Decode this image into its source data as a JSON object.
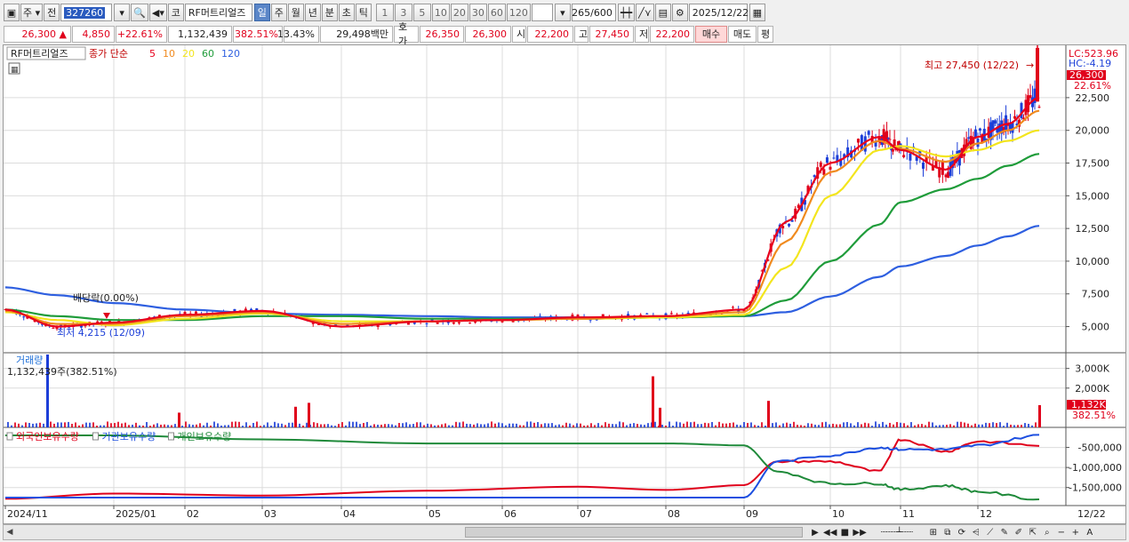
{
  "toolbar": {
    "market_label": "주",
    "prev_label": "전",
    "code_value": "327260",
    "name_label": "코",
    "stock_name": "RF머트리얼즈",
    "period_buttons": [
      "일",
      "주",
      "월",
      "년",
      "분",
      "초",
      "틱"
    ],
    "selected_period": "일",
    "interval_buttons": [
      "1",
      "3",
      "5",
      "10",
      "20",
      "30",
      "60",
      "120"
    ],
    "count_value": "265",
    "count_total": "/600",
    "date_value": "2025/12/22"
  },
  "price_bar": {
    "price": "26,300",
    "change_arrow": "▲",
    "change": "4,850",
    "change_pct": "+22.61%",
    "volume": "1,132,439",
    "volume_ratio": "382.51%",
    "turnover": "13.43%",
    "amount": "29,498백만",
    "quote_label": "호가",
    "quote_ask": "26,350",
    "quote_bid": "26,300",
    "open_label": "시",
    "open": "22,200",
    "high_label": "고",
    "high": "27,450",
    "low_label": "저",
    "low": "22,200",
    "buy_label": "매수",
    "sell_label": "매도",
    "eval_label": "평"
  },
  "chart": {
    "legend_name": "RF머트리얼즈",
    "legend_series": "종가 단순",
    "ma_periods": [
      "5",
      "10",
      "20",
      "60",
      "120"
    ],
    "ma_colors": [
      "#e8001c",
      "#f08a1e",
      "#f3e51d",
      "#1f9c3a",
      "#2e5fe0"
    ],
    "lc_label": "LC:523.96",
    "hc_label": "HC:-4.19",
    "price_tag": "26,300",
    "pct_tag": "22.61%",
    "high_annotation": "최고 27,450 (12/22)",
    "low_annotation": "최저 4,215 (12/09)",
    "dividend_label": "배당락(0.00%)",
    "volume_title": "거래량",
    "volume_value": "1,132,439주(382.51%)",
    "volume_tag": "1,132K",
    "volume_pct_tag": "382.51%",
    "holdings_legend": [
      "외국인보유수량",
      "기관보유수량",
      "개인보유수량"
    ],
    "holdings_colors": [
      "#e0001b",
      "#1d4fe0",
      "#1f8a3a"
    ],
    "last_date_label": "12/22"
  },
  "chart_data": [
    {
      "type": "line",
      "title": "",
      "x_tick_labels": [
        "2024/11",
        "2025/01",
        "02",
        "03",
        "04",
        "05",
        "06",
        "07",
        "08",
        "09",
        "10",
        "11",
        "12"
      ],
      "y_ticks": [
        5000,
        7500,
        10000,
        12500,
        15000,
        17500,
        20000,
        22500
      ],
      "y_tick_labels": [
        "5,000",
        "7,500",
        "10,000",
        "12,500",
        "15,000",
        "17,500",
        "20,000",
        "22,500"
      ],
      "ylim": [
        3000,
        26500
      ],
      "x": [
        "2024/11",
        "2024/12",
        "2025/01",
        "02",
        "03",
        "04",
        "05",
        "06",
        "07",
        "08",
        "09-early",
        "09-late",
        "10-early",
        "10-late",
        "11-early",
        "11-late",
        "12-early",
        "12-mid",
        "12/22"
      ],
      "series": [
        {
          "name": "5",
          "values": [
            6300,
            5000,
            5300,
            5900,
            6200,
            5000,
            5400,
            5500,
            5700,
            5800,
            6300,
            13000,
            17500,
            19500,
            18500,
            17000,
            19500,
            20500,
            22500
          ]
        },
        {
          "name": "10",
          "values": [
            6200,
            5200,
            5200,
            5800,
            6100,
            5200,
            5400,
            5500,
            5600,
            5800,
            6100,
            11500,
            16800,
            19200,
            18600,
            17600,
            19000,
            20000,
            21500
          ]
        },
        {
          "name": "20",
          "values": [
            6100,
            5500,
            5100,
            5600,
            6000,
            5400,
            5400,
            5500,
            5600,
            5700,
            5900,
            9500,
            15000,
            18500,
            18800,
            18000,
            18500,
            19200,
            20000
          ]
        },
        {
          "name": "60",
          "values": [
            6300,
            5800,
            5500,
            5500,
            5800,
            5800,
            5600,
            5600,
            5600,
            5700,
            5800,
            7000,
            10000,
            12800,
            14500,
            15500,
            16300,
            17300,
            18200
          ]
        },
        {
          "name": "120",
          "values": [
            8000,
            7400,
            6800,
            6300,
            6000,
            5900,
            5800,
            5700,
            5700,
            5700,
            5800,
            6100,
            7300,
            8800,
            9600,
            10400,
            11200,
            11900,
            12700
          ]
        }
      ]
    },
    {
      "type": "bar",
      "title": "",
      "y_ticks": [
        2000000,
        3000000
      ],
      "y_tick_labels": [
        "2,000K",
        "3,000K"
      ],
      "ylim": [
        0,
        3800000
      ],
      "spikes": [
        {
          "x": "2024/12",
          "value": 3900000,
          "color": "#1d3fd8"
        },
        {
          "x": "01",
          "value": 750000,
          "color": "#e0001b"
        },
        {
          "x": "03-mid",
          "value": 1050000,
          "color": "#e0001b"
        },
        {
          "x": "03-late",
          "value": 1250000,
          "color": "#e0001b"
        },
        {
          "x": "07-late",
          "value": 2600000,
          "color": "#e0001b"
        },
        {
          "x": "08-early",
          "value": 1000000,
          "color": "#e0001b"
        },
        {
          "x": "09-early",
          "value": 1350000,
          "color": "#e0001b"
        },
        {
          "x": "12/22",
          "value": 1132439,
          "color": "#e0001b"
        }
      ]
    },
    {
      "type": "line",
      "title": "",
      "y_ticks": [
        -500000,
        -1000000,
        -1500000
      ],
      "y_tick_labels": [
        "-500,000",
        "-1,000,000",
        "-1,500,000"
      ],
      "ylim": [
        -1950000,
        0
      ],
      "x": [
        "2024/11",
        "2025/01",
        "03",
        "05",
        "07",
        "08",
        "09",
        "09-late",
        "10",
        "10-late",
        "11",
        "11-late",
        "12",
        "12/22"
      ],
      "series": [
        {
          "name": "외국인보유수량",
          "values": [
            -1780000,
            -1650000,
            -1700000,
            -1580000,
            -1480000,
            -1560000,
            -1440000,
            -850000,
            -850000,
            -1100000,
            -300000,
            -600000,
            -350000,
            -450000
          ]
        },
        {
          "name": "기관보유수량",
          "values": [
            -1750000,
            -1750000,
            -1750000,
            -1750000,
            -1750000,
            -1750000,
            -1750000,
            -850000,
            -700000,
            -500000,
            -550000,
            -550000,
            -450000,
            -200000
          ]
        },
        {
          "name": "개인보유수량",
          "values": [
            -200000,
            -200000,
            -300000,
            -400000,
            -400000,
            -400000,
            -450000,
            -1100000,
            -1400000,
            -1400000,
            -1550000,
            -1450000,
            -1600000,
            -1800000
          ]
        }
      ]
    }
  ]
}
